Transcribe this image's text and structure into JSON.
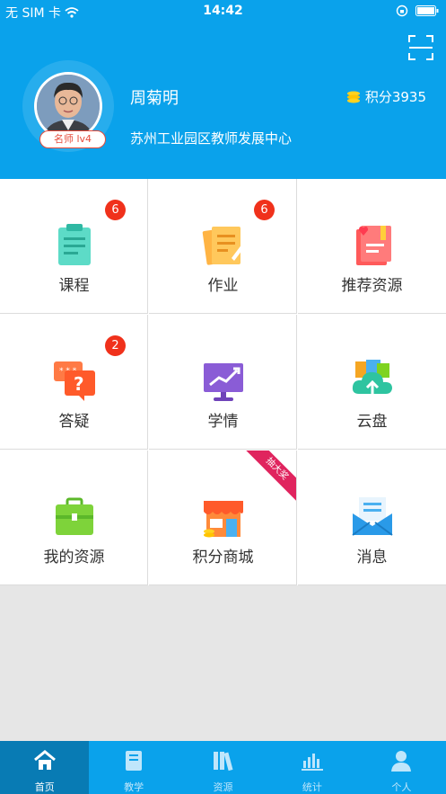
{
  "status_bar": {
    "carrier": "无 SIM 卡",
    "time": "14:42"
  },
  "profile": {
    "name": "周菊明",
    "level": "名师 lv4",
    "points": "积分3935",
    "organization": "苏州工业园区教师发展中心"
  },
  "grid": [
    {
      "label": "课程",
      "badge": "6"
    },
    {
      "label": "作业",
      "badge": "6"
    },
    {
      "label": "推荐资源"
    },
    {
      "label": "答疑",
      "badge": "2"
    },
    {
      "label": "学情"
    },
    {
      "label": "云盘"
    },
    {
      "label": "我的资源"
    },
    {
      "label": "积分商城",
      "ribbon": "抽大奖"
    },
    {
      "label": "消息"
    }
  ],
  "tabs": [
    {
      "label": "首页",
      "icon": "home-icon",
      "active": true
    },
    {
      "label": "教学",
      "icon": "book-icon"
    },
    {
      "label": "资源",
      "icon": "library-icon"
    },
    {
      "label": "统计",
      "icon": "bar-chart-icon"
    },
    {
      "label": "个人",
      "icon": "person-icon"
    }
  ],
  "colors": {
    "header": "#0aa2eb",
    "badge": "#f0311b",
    "tab_active": "#087bb4"
  }
}
